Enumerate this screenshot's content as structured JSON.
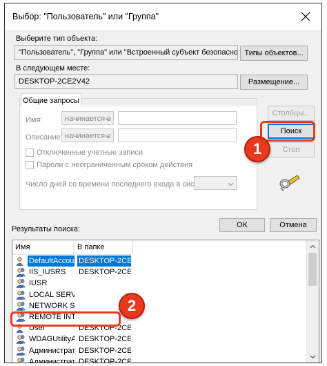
{
  "window": {
    "title": "Выбор: \"Пользователь\" или \"Группа\""
  },
  "object_type": {
    "label": "Выберите тип объекта:",
    "value": "\"Пользователь\", \"Группа\" или \"Встроенный субъект безопасности\"",
    "button": "Типы объектов..."
  },
  "location": {
    "label": "В следующем месте:",
    "value": "DESKTOP-2CE2V42",
    "button": "Размещение..."
  },
  "common_queries": {
    "tab_label": "Общие запросы",
    "name_label": "Имя:",
    "name_combo": "начинается с",
    "description_label": "Описание:",
    "description_combo": "начинается с",
    "disabled_accounts_label": "Отключенные учетные записи",
    "no_expire_password_label": "Пароли с неограниченным сроком действия",
    "days_since_login_label": "Число дней со времени последнего входа в систему:"
  },
  "buttons": {
    "columns": "Столбцы...",
    "search": "Поиск",
    "stop": "Стоп",
    "ok": "OK",
    "cancel": "Отмена"
  },
  "results": {
    "label": "Результаты поиска:",
    "col_name": "Имя",
    "col_folder": "В папке",
    "rows": [
      {
        "name": "DefaultAccount",
        "folder": "DESKTOP-2CE...",
        "selected": true
      },
      {
        "name": "IIS_IUSRS",
        "folder": "DESKTOP-2CE..."
      },
      {
        "name": "IUSR",
        "folder": ""
      },
      {
        "name": "LOCAL SERV...",
        "folder": ""
      },
      {
        "name": "NETWORK S...",
        "folder": ""
      },
      {
        "name": "REMOTE INT...",
        "folder": ""
      },
      {
        "name": "User",
        "folder": "DESKTOP-2CE..."
      },
      {
        "name": "WDAGUtilityA...",
        "folder": "DESKTOP-2CE..."
      },
      {
        "name": "Администрат...",
        "folder": "DESKTOP-2CE..."
      },
      {
        "name": "Администрат...",
        "folder": "DESKTOP-2CE..."
      }
    ]
  },
  "callouts": {
    "first": "1",
    "second": "2"
  },
  "colors": {
    "accent": "#0078d7",
    "callout_red": "#e8391f"
  }
}
